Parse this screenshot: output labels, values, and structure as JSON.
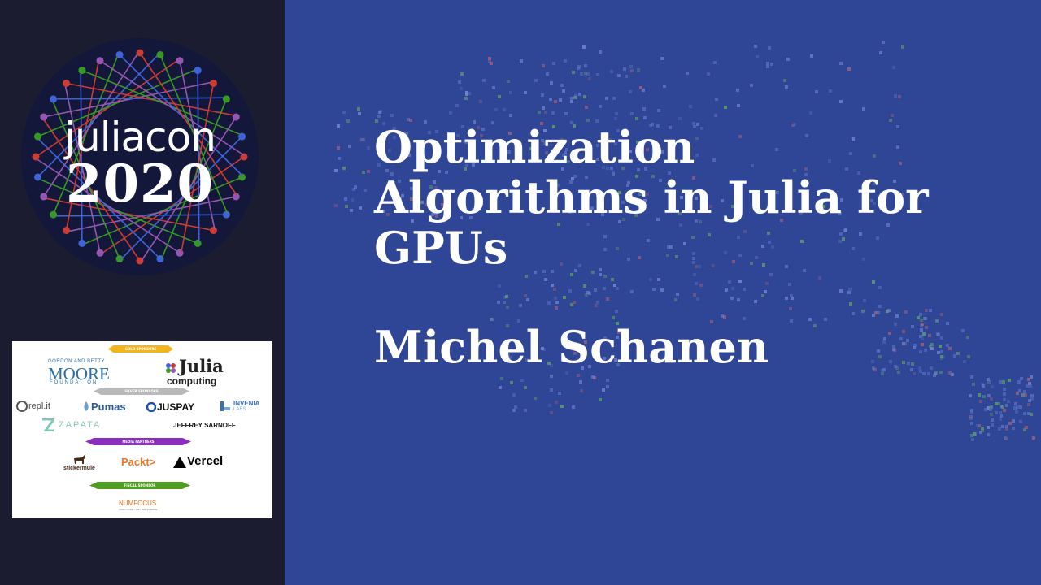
{
  "logo": {
    "word": "juliacon",
    "year": "2020"
  },
  "sponsors": {
    "gold_banner": "GOLD SPONSORS",
    "silver_banner": "SILVER SPONSORS",
    "media_banner": "MEDIA PARTNERS",
    "fiscal_banner": "FISCAL SPONSOR",
    "moore_top": "GORDON AND BETTY",
    "moore_main": "MOORE",
    "moore_bottom": "FOUNDATION",
    "julia_main": "Julia",
    "julia_sub": "computing",
    "replit": "repl.it",
    "pumas": "Pumas",
    "juspay": "JUSPAY",
    "invenia": "INVENIA",
    "invenia_sub": "LABS",
    "zapata": "ZAPATA",
    "jeffrey": "JEFFREY SARNOFF",
    "stickermule": "stickermule",
    "packt": "Packt>",
    "vercel": "Vercel",
    "numfocus": "NUMFOCUS",
    "numfocus_sub": "OPEN CODE = BETTER SCIENCE"
  },
  "talk": {
    "title_lines": [
      "Optimization",
      "Algorithms in Julia for",
      "GPUs"
    ],
    "speaker": "Michel Schanen"
  },
  "colors": {
    "left_bg": "#1c1c31",
    "right_bg": "#2f4596",
    "julia_red": "#cb3c33",
    "julia_green": "#389826",
    "julia_purple": "#9558b2",
    "julia_blue": "#4063d8"
  }
}
